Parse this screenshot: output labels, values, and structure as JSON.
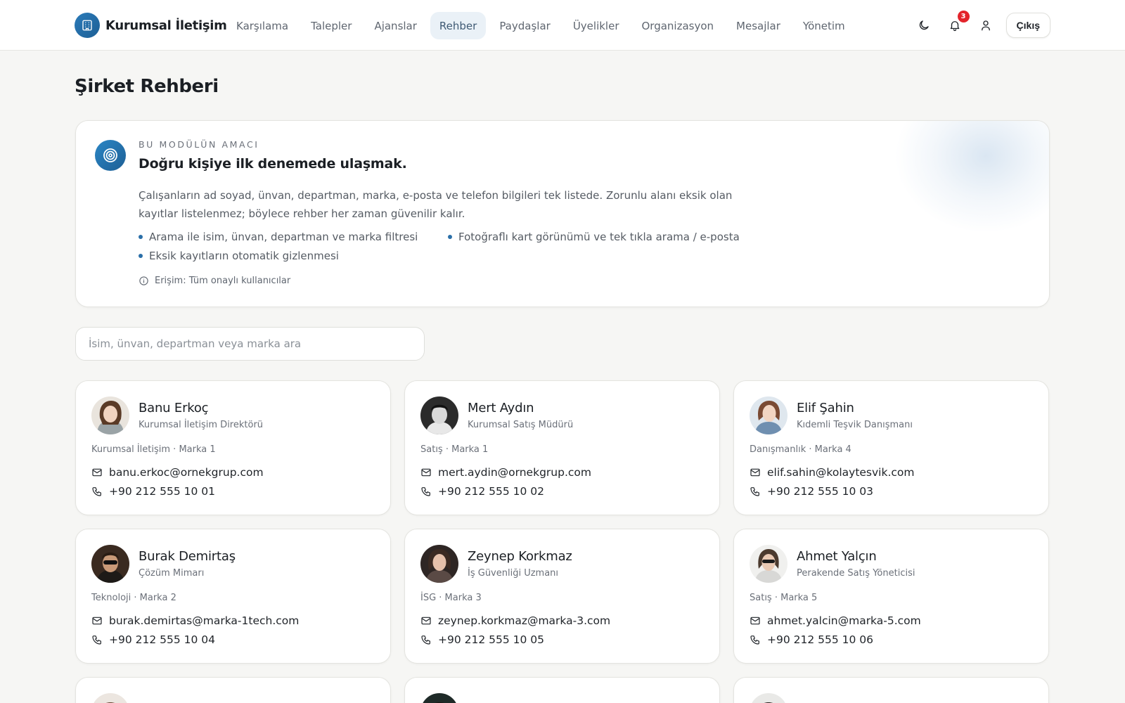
{
  "header": {
    "brand": "Kurumsal İletişim",
    "nav": [
      {
        "label": "Karşılama",
        "active": false
      },
      {
        "label": "Talepler",
        "active": false
      },
      {
        "label": "Ajanslar",
        "active": false
      },
      {
        "label": "Rehber",
        "active": true
      },
      {
        "label": "Paydaşlar",
        "active": false
      },
      {
        "label": "Üyelikler",
        "active": false
      },
      {
        "label": "Organizasyon",
        "active": false
      },
      {
        "label": "Mesajlar",
        "active": false
      },
      {
        "label": "Yönetim",
        "active": false
      }
    ],
    "notification_count": "3",
    "logout_label": "Çıkış",
    "icons": [
      "theme-toggle-icon",
      "bell-icon",
      "user-icon"
    ]
  },
  "page": {
    "title": "Şirket Rehberi"
  },
  "purpose": {
    "eyebrow": "BU MODÜLÜN AMACI",
    "heading": "Doğru kişiye ilk denemede ulaşmak.",
    "description": "Çalışanların ad soyad, ünvan, departman, marka, e-posta ve telefon bilgileri tek listede. Zorunlu alanı eksik olan kayıtlar listelenmez; böylece rehber her zaman güvenilir kalır.",
    "bullets": [
      "Arama ile isim, ünvan, departman ve marka filtresi",
      "Fotoğraflı kart görünümü ve tek tıkla arama / e-posta",
      "Eksik kayıtların otomatik gizlenmesi"
    ],
    "access": "Erişim: Tüm onaylı kullanıcılar"
  },
  "search": {
    "placeholder": "İsim, ünvan, departman veya marka ara",
    "value": ""
  },
  "people": [
    {
      "name": "Banu Erkoç",
      "title": "Kurumsal İletişim Direktörü",
      "meta": "Kurumsal İletişim · Marka 1",
      "email": "banu.erkoc@ornekgrup.com",
      "phone": "+90 212 555 10 01"
    },
    {
      "name": "Mert Aydın",
      "title": "Kurumsal Satış Müdürü",
      "meta": "Satış · Marka 1",
      "email": "mert.aydin@ornekgrup.com",
      "phone": "+90 212 555 10 02"
    },
    {
      "name": "Elif Şahin",
      "title": "Kıdemli Teşvik Danışmanı",
      "meta": "Danışmanlık · Marka 4",
      "email": "elif.sahin@kolaytesvik.com",
      "phone": "+90 212 555 10 03"
    },
    {
      "name": "Burak Demirtaş",
      "title": "Çözüm Mimarı",
      "meta": "Teknoloji · Marka 2",
      "email": "burak.demirtas@marka-1tech.com",
      "phone": "+90 212 555 10 04"
    },
    {
      "name": "Zeynep Korkmaz",
      "title": "İş Güvenliği Uzmanı",
      "meta": "İSG · Marka 3",
      "email": "zeynep.korkmaz@marka-3.com",
      "phone": "+90 212 555 10 05"
    },
    {
      "name": "Ahmet Yalçın",
      "title": "Perakende Satış Yöneticisi",
      "meta": "Satış · Marka 5",
      "email": "ahmet.yalcin@marka-5.com",
      "phone": "+90 212 555 10 06"
    }
  ],
  "colors": {
    "accent": "#2a6fa8",
    "badge": "#e3242b",
    "background": "#f6f6f4"
  }
}
